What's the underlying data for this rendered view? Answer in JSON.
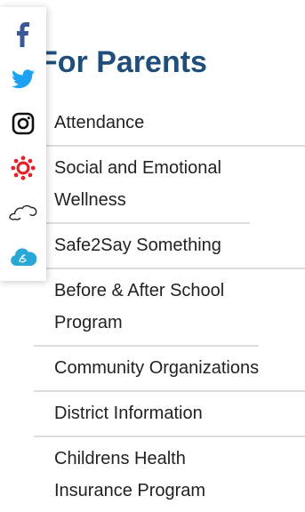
{
  "heading": {
    "visible_text": "For Parents"
  },
  "menu": {
    "items": [
      {
        "label": "Attendance"
      },
      {
        "label": "Social and Emotional Wellness"
      },
      {
        "label": "Safe2Say Something"
      },
      {
        "label": "Before & After School Program"
      },
      {
        "label": "Community Organizations"
      },
      {
        "label": "District Information"
      },
      {
        "label": "Childrens Health Insurance Program"
      }
    ]
  },
  "social_bar": {
    "icons": [
      {
        "name": "facebook-icon",
        "color": "#3b5998"
      },
      {
        "name": "twitter-icon",
        "color": "#1da1f2"
      },
      {
        "name": "instagram-icon",
        "color": "#111111"
      },
      {
        "name": "canvas-lms-icon",
        "color": "#e4232b"
      },
      {
        "name": "cloud-swirl-icon",
        "color": "#222222"
      },
      {
        "name": "cloud-app-icon",
        "color": "#29a8d8"
      }
    ]
  },
  "colors": {
    "heading": "#1f4e79",
    "divider": "#dddddd",
    "text": "#222222"
  }
}
